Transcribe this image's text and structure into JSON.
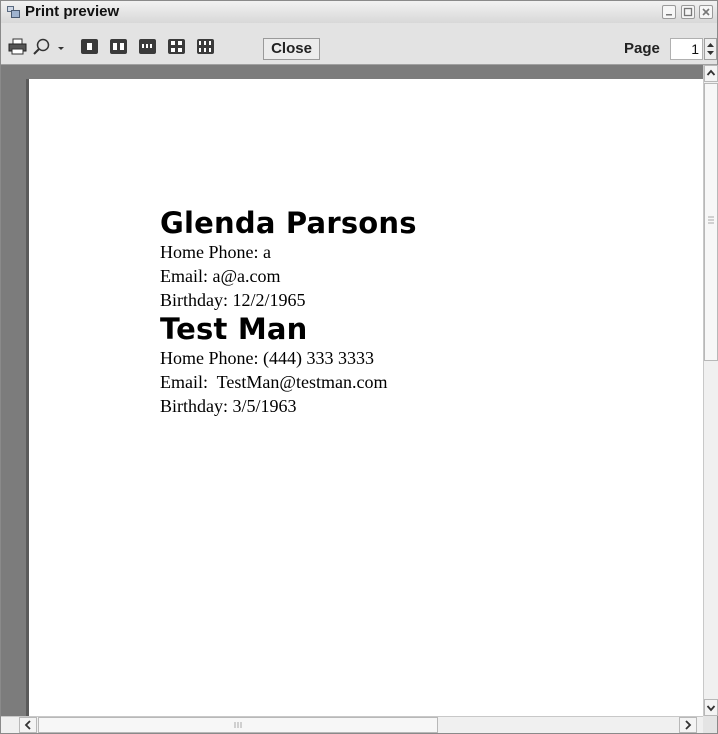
{
  "window": {
    "title": "Print preview",
    "icon": "print-preview-window-icon",
    "controls": [
      "minimize-icon",
      "maximize-icon",
      "close-icon"
    ]
  },
  "toolbar": {
    "print_icon": "printer-icon",
    "zoom_icon": "magnifier-icon",
    "zoom_dropdown_icon": "chevron-down-icon",
    "layout_buttons": [
      "one-page-icon",
      "two-pages-icon",
      "three-pages-icon",
      "four-pages-icon",
      "six-pages-icon"
    ],
    "close_label": "Close",
    "page_label": "Page",
    "page_value": "1"
  },
  "document": {
    "contacts": [
      {
        "name": "Glenda Parsons",
        "home_phone": "Home Phone: a",
        "email": "Email: a@a.com",
        "birthday": "Birthday: 12/2/1965"
      },
      {
        "name": "Test Man",
        "home_phone": "Home Phone: (444) 333 3333",
        "email": "Email:  TestMan@testman.com",
        "birthday": "Birthday: 3/5/1963"
      }
    ]
  },
  "scrollbars": {
    "vertical": [
      "scroll-up-icon",
      "scroll-down-icon"
    ],
    "horizontal": [
      "scroll-left-icon",
      "scroll-right-icon"
    ]
  },
  "colors": {
    "preview_background": "#7c7c7c",
    "page": "#ffffff",
    "toolbar": "#e3e3e3"
  }
}
